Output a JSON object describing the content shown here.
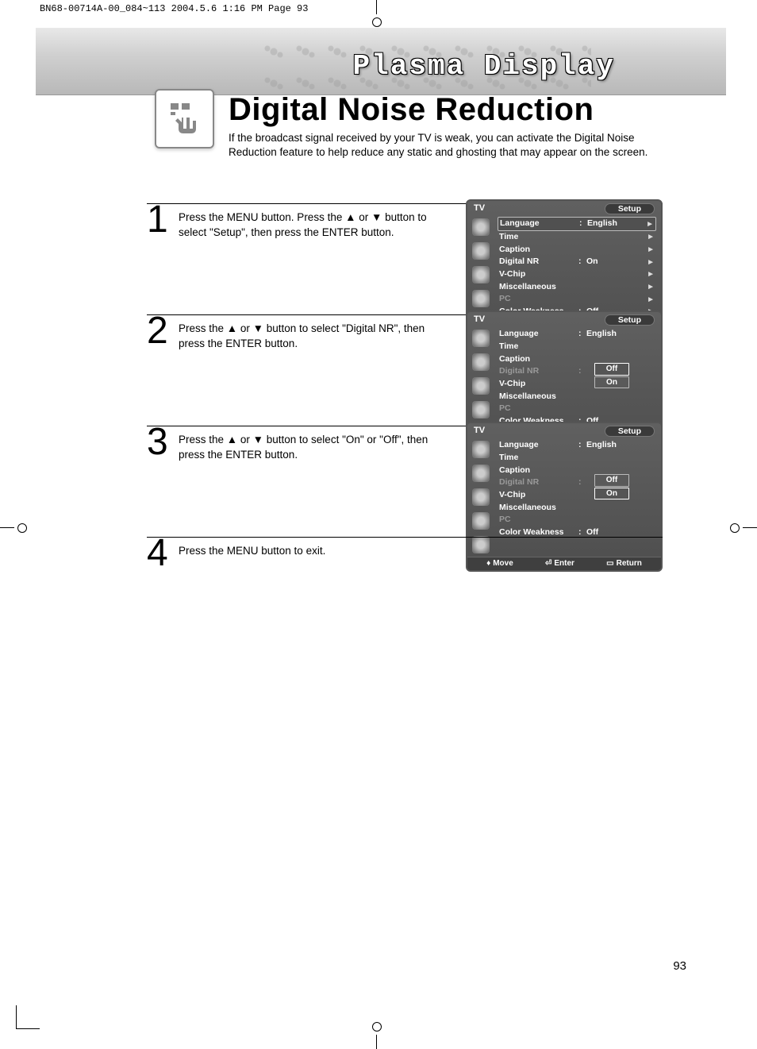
{
  "print_header": "BN68-00714A-00_084~113  2004.5.6  1:16 PM  Page 93",
  "banner_title": "Plasma Display",
  "main_title": "Digital Noise Reduction",
  "intro": "If the broadcast signal received by your TV is weak, you can activate the Digital Noise Reduction feature to help reduce any static and ghosting that may appear on the screen.",
  "steps": [
    {
      "num": "1",
      "text": "Press the MENU button. Press the ▲ or ▼ button to select \"Setup\", then press the ENTER button."
    },
    {
      "num": "2",
      "text": "Press the ▲ or ▼ button to select \"Digital NR\", then press the ENTER button."
    },
    {
      "num": "3",
      "text": "Press the ▲ or ▼ button to select \"On\" or \"Off\", then press the ENTER button."
    },
    {
      "num": "4",
      "text": "Press the MENU button to exit."
    }
  ],
  "osd_common": {
    "tv_label": "TV",
    "setup_label": "Setup",
    "rows": {
      "language": "Language",
      "time": "Time",
      "caption": "Caption",
      "digital_nr": "Digital NR",
      "vchip": "V-Chip",
      "misc": "Miscellaneous",
      "pc": "PC",
      "color_weakness": "Color Weakness"
    },
    "values": {
      "english": "English",
      "on": "On",
      "off": "Off"
    },
    "footer": {
      "move": "Move",
      "enter": "Enter",
      "return": "Return"
    },
    "options": {
      "off": "Off",
      "on": "On"
    }
  },
  "page_number": "93"
}
